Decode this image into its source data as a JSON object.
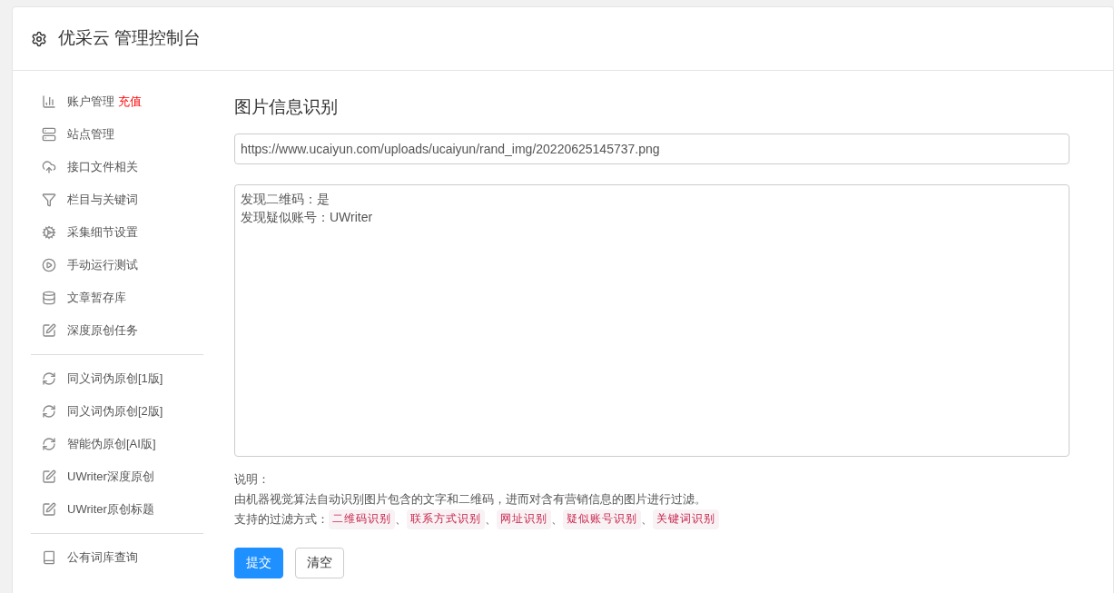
{
  "header": {
    "title": "优采云 管理控制台"
  },
  "sidebar": {
    "groups": [
      {
        "items": [
          {
            "label": "账户管理",
            "badge": "充值"
          },
          {
            "label": "站点管理"
          },
          {
            "label": "接口文件相关"
          },
          {
            "label": "栏目与关键词"
          },
          {
            "label": "采集细节设置"
          },
          {
            "label": "手动运行测试"
          },
          {
            "label": "文章暂存库"
          },
          {
            "label": "深度原创任务"
          }
        ]
      },
      {
        "items": [
          {
            "label": "同义词伪原创[1版]"
          },
          {
            "label": "同义词伪原创[2版]"
          },
          {
            "label": "智能伪原创[AI版]"
          },
          {
            "label": "UWriter深度原创"
          },
          {
            "label": "UWriter原创标题"
          }
        ]
      },
      {
        "items": [
          {
            "label": "公有词库查询"
          }
        ]
      }
    ]
  },
  "main": {
    "title": "图片信息识别",
    "url_field": {
      "value": "https://www.ucaiyun.com/uploads/ucaiyun/rand_img/20220625145737.png"
    },
    "result_field": {
      "lines": [
        "发现二维码：是",
        "发现疑似账号：UWriter"
      ]
    },
    "note_label": "说明：",
    "note_text": "由机器视觉算法自动识别图片包含的文字和二维码，进而对含有营销信息的图片进行过滤。",
    "filters_label": "支持的过滤方式：",
    "filters": [
      "二维码识别",
      "联系方式识别",
      "网址识别",
      "疑似账号识别",
      "关键词识别"
    ],
    "separator": "、",
    "buttons": [
      {
        "label": "提交",
        "kind": "primary"
      },
      {
        "label": "清空",
        "kind": "default"
      }
    ]
  }
}
